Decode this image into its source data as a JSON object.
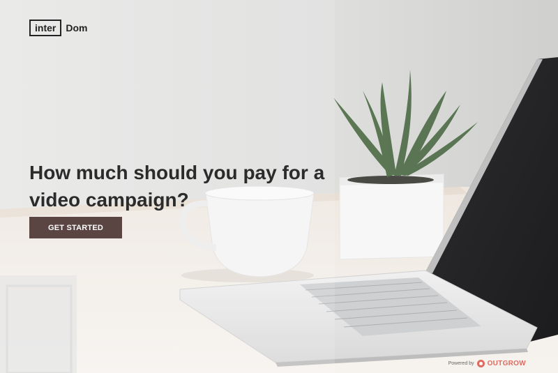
{
  "brand": {
    "logo_part1": "inter",
    "logo_part2": "Dom"
  },
  "hero": {
    "headline": "How much should you pay for a video campaign?",
    "cta_label": "GET STARTED"
  },
  "footer": {
    "powered_by": "Powered by",
    "powered_brand": "OUTGROW"
  },
  "colors": {
    "cta_background": "#5a4542",
    "headline_text": "#2b2b2b",
    "outgrow_brand": "#e06a5e"
  }
}
